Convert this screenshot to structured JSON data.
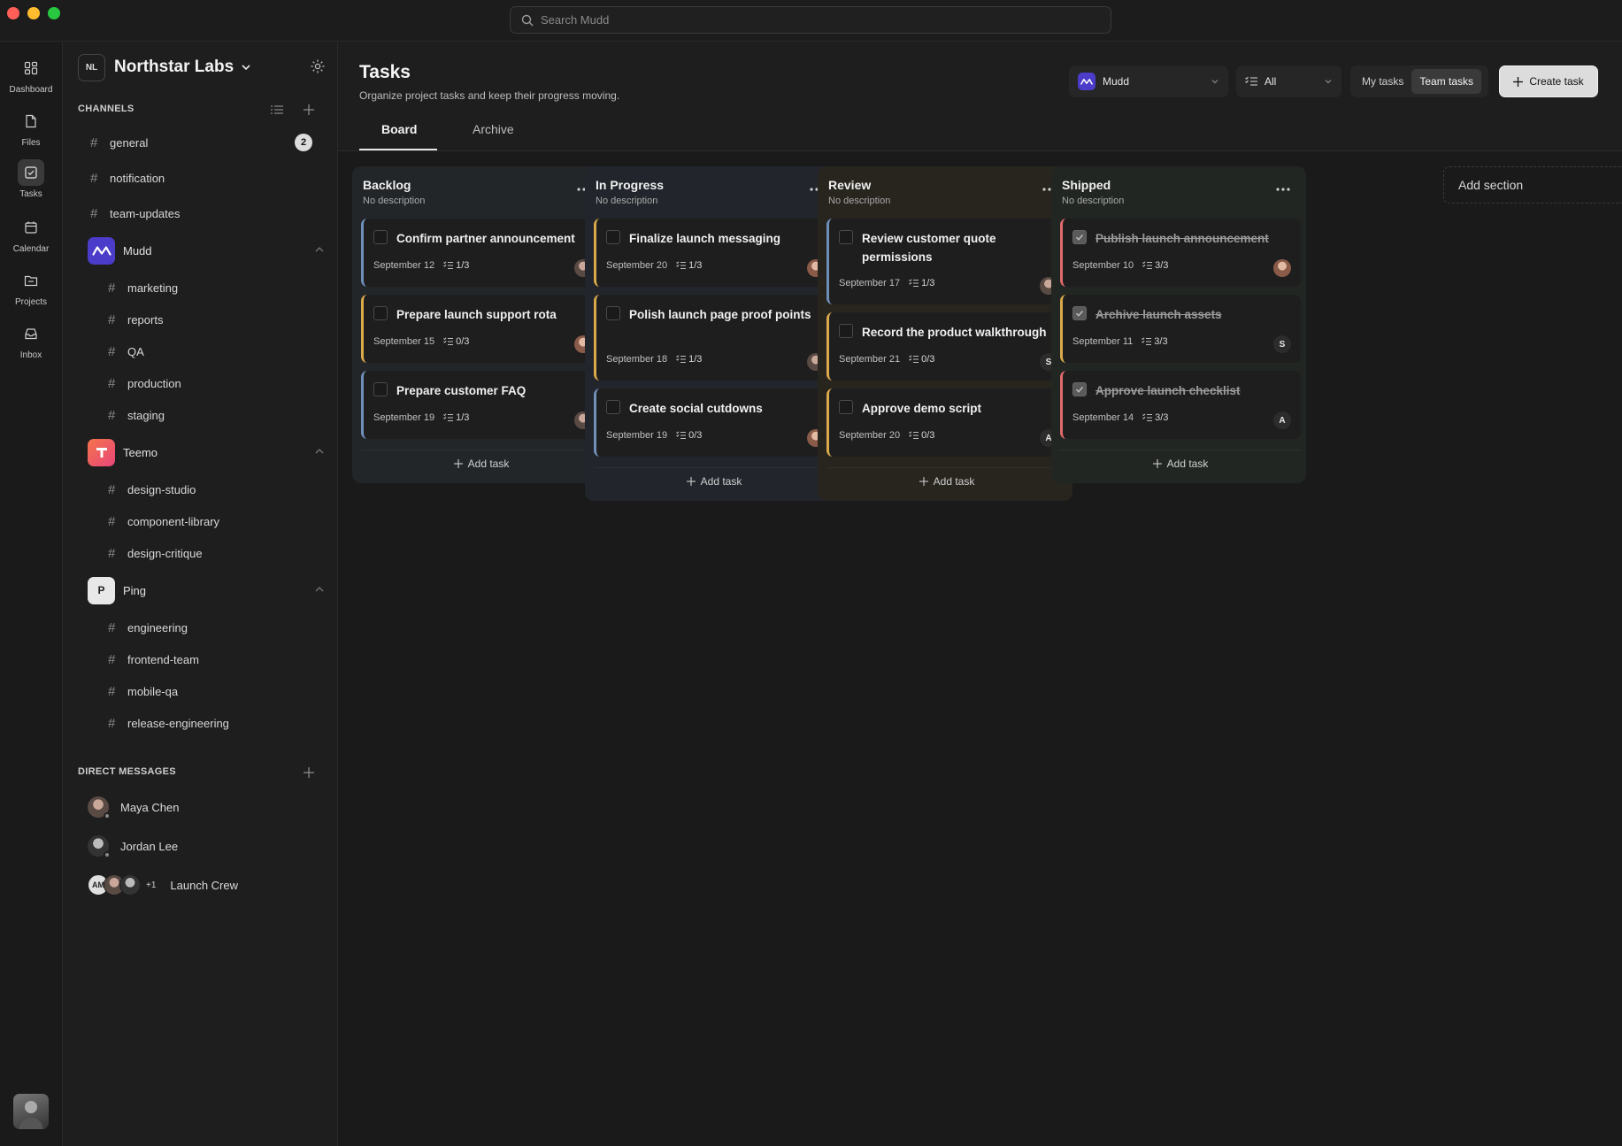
{
  "search": {
    "placeholder": "Search Mudd"
  },
  "rail": [
    {
      "label": "Dashboard",
      "icon": "dashboard-icon"
    },
    {
      "label": "Files",
      "icon": "file-icon"
    },
    {
      "label": "Tasks",
      "icon": "tasks-icon",
      "active": true
    },
    {
      "label": "Calendar",
      "icon": "calendar-icon"
    },
    {
      "label": "Projects",
      "icon": "projects-icon"
    },
    {
      "label": "Inbox",
      "icon": "inbox-icon"
    }
  ],
  "workspace": {
    "initials": "NL",
    "name": "Northstar Labs"
  },
  "channels": {
    "title": "CHANNELS",
    "top": [
      {
        "name": "general",
        "badge": "2"
      },
      {
        "name": "notification"
      },
      {
        "name": "team-updates"
      }
    ],
    "groups": [
      {
        "name": "Mudd",
        "channels": [
          "marketing",
          "reports",
          "QA",
          "production",
          "staging"
        ]
      },
      {
        "name": "Teemo",
        "channels": [
          "design-studio",
          "component-library",
          "design-critique"
        ]
      },
      {
        "name": "Ping",
        "initial": "P",
        "channels": [
          "engineering",
          "frontend-team",
          "mobile-qa",
          "release-engineering"
        ]
      }
    ]
  },
  "direct_messages": {
    "title": "DIRECT MESSAGES",
    "items": [
      {
        "name": "Maya Chen"
      },
      {
        "name": "Jordan Lee"
      },
      {
        "name": "Launch Crew",
        "initials": "AM",
        "extra": "+1"
      }
    ]
  },
  "header": {
    "title": "Tasks",
    "subtitle": "Organize project tasks and keep their progress moving.",
    "tabs": [
      "Board",
      "Archive"
    ],
    "project_select": "Mudd",
    "filter_select": "All",
    "segments": [
      "My tasks",
      "Team tasks"
    ],
    "create_label": "Create task"
  },
  "board": {
    "columns": [
      {
        "title": "Backlog",
        "desc": "No description",
        "bg": "#232629",
        "accent": "#6f8fb8",
        "cards": [
          {
            "title": "Confirm partner announcement",
            "date": "September 12",
            "sub": "1/3",
            "accent": "#6f8fb8"
          },
          {
            "title": "Prepare launch support rota",
            "date": "September 15",
            "sub": "0/3",
            "accent": "#d9a94a"
          },
          {
            "title": "Prepare customer FAQ",
            "date": "September 19",
            "sub": "1/3",
            "accent": "#6f8fb8"
          }
        ]
      },
      {
        "title": "In Progress",
        "desc": "No description",
        "bg": "#22262c",
        "accent": "#d9a94a",
        "cards": [
          {
            "title": "Finalize launch messaging",
            "date": "September 20",
            "sub": "1/3",
            "accent": "#d9a94a"
          },
          {
            "title": "Polish launch page proof points",
            "date": "September 18",
            "sub": "1/3",
            "accent": "#d9a94a"
          },
          {
            "title": "Create social cutdowns",
            "date": "September 19",
            "sub": "0/3",
            "accent": "#6f8fb8"
          }
        ]
      },
      {
        "title": "Review",
        "desc": "No description",
        "bg": "#28251f",
        "cards": [
          {
            "title": "Review customer quote permissions",
            "date": "September 17",
            "sub": "1/3",
            "accent": "#6f8fb8"
          },
          {
            "title": "Record the product walkthrough",
            "date": "September 21",
            "sub": "0/3",
            "accent": "#d9a94a",
            "assignee": "S"
          },
          {
            "title": "Approve demo script",
            "date": "September 20",
            "sub": "0/3",
            "accent": "#d9a94a",
            "assignee": "A"
          }
        ]
      },
      {
        "title": "Shipped",
        "desc": "No description",
        "bg": "#222622",
        "cards": [
          {
            "title": "Publish launch announcement",
            "date": "September 10",
            "sub": "3/3",
            "accent": "#e06a6a",
            "done": true
          },
          {
            "title": "Archive launch assets",
            "date": "September 11",
            "sub": "3/3",
            "accent": "#d9a94a",
            "done": true,
            "assignee": "S"
          },
          {
            "title": "Approve launch checklist",
            "date": "September 14",
            "sub": "3/3",
            "accent": "#e06a6a",
            "done": true,
            "assignee": "A"
          }
        ]
      }
    ],
    "add_task_label": "Add task",
    "add_section_label": "Add section"
  }
}
